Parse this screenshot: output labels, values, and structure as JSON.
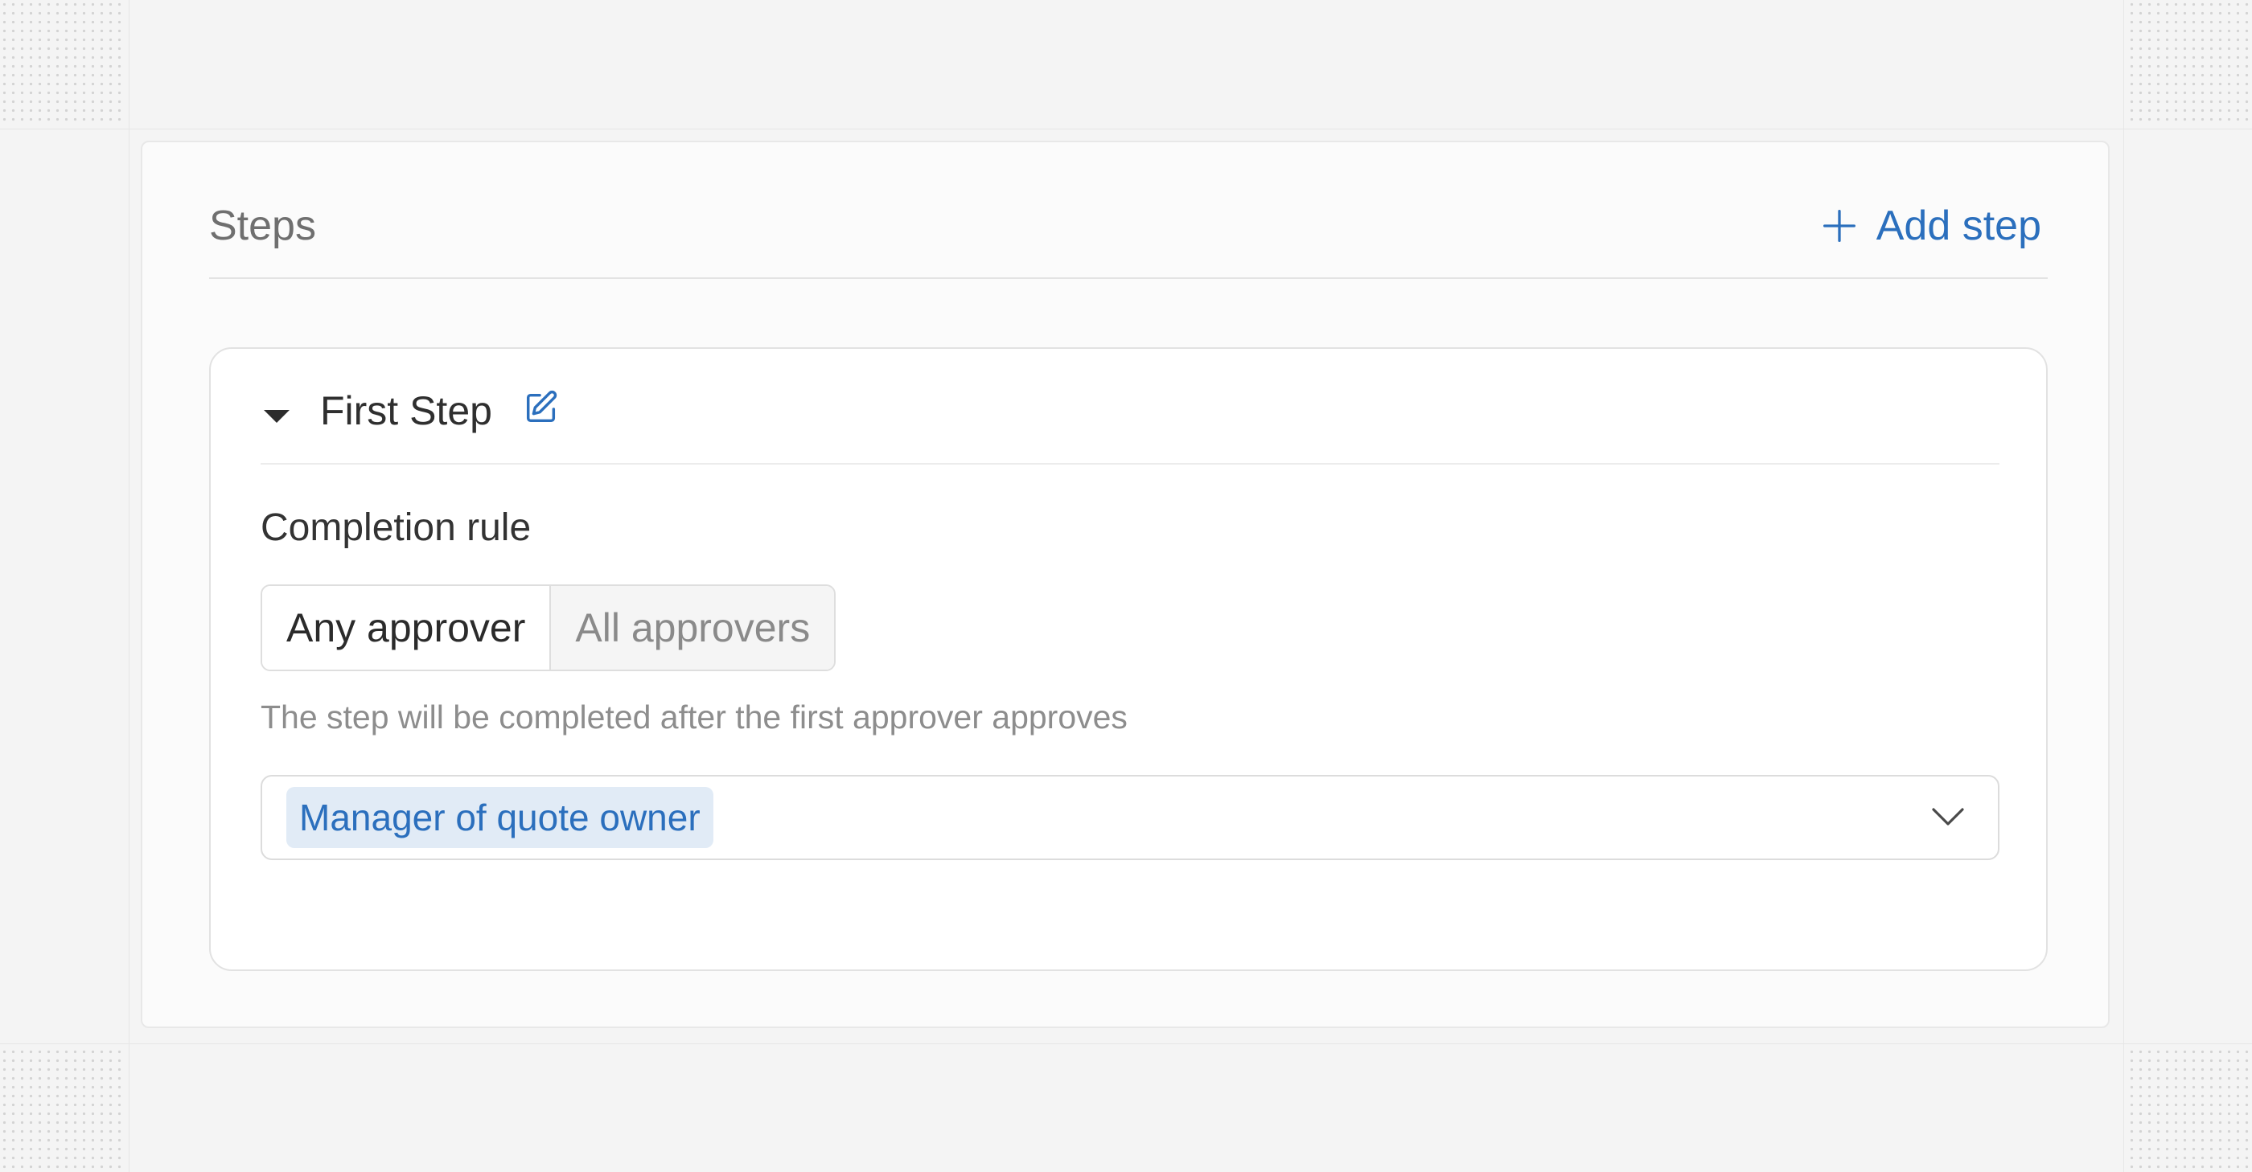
{
  "section": {
    "title": "Steps",
    "add_step_label": "Add step",
    "add_icon": "plus-icon"
  },
  "step": {
    "name": "First Step",
    "toggle_icon": "caret-down-icon",
    "edit_icon": "edit-icon",
    "completion_rule": {
      "label": "Completion rule",
      "options": [
        "Any approver",
        "All approvers"
      ],
      "selected": "Any approver",
      "helper_text": "The step will be completed after the first approver approves"
    },
    "approvers": {
      "selected": [
        "Manager of quote owner"
      ],
      "dropdown_icon": "chevron-down-icon"
    }
  },
  "colors": {
    "accent": "#2b6fbd",
    "chip_background": "#e1ebf6",
    "page_background": "#f4f4f4"
  }
}
